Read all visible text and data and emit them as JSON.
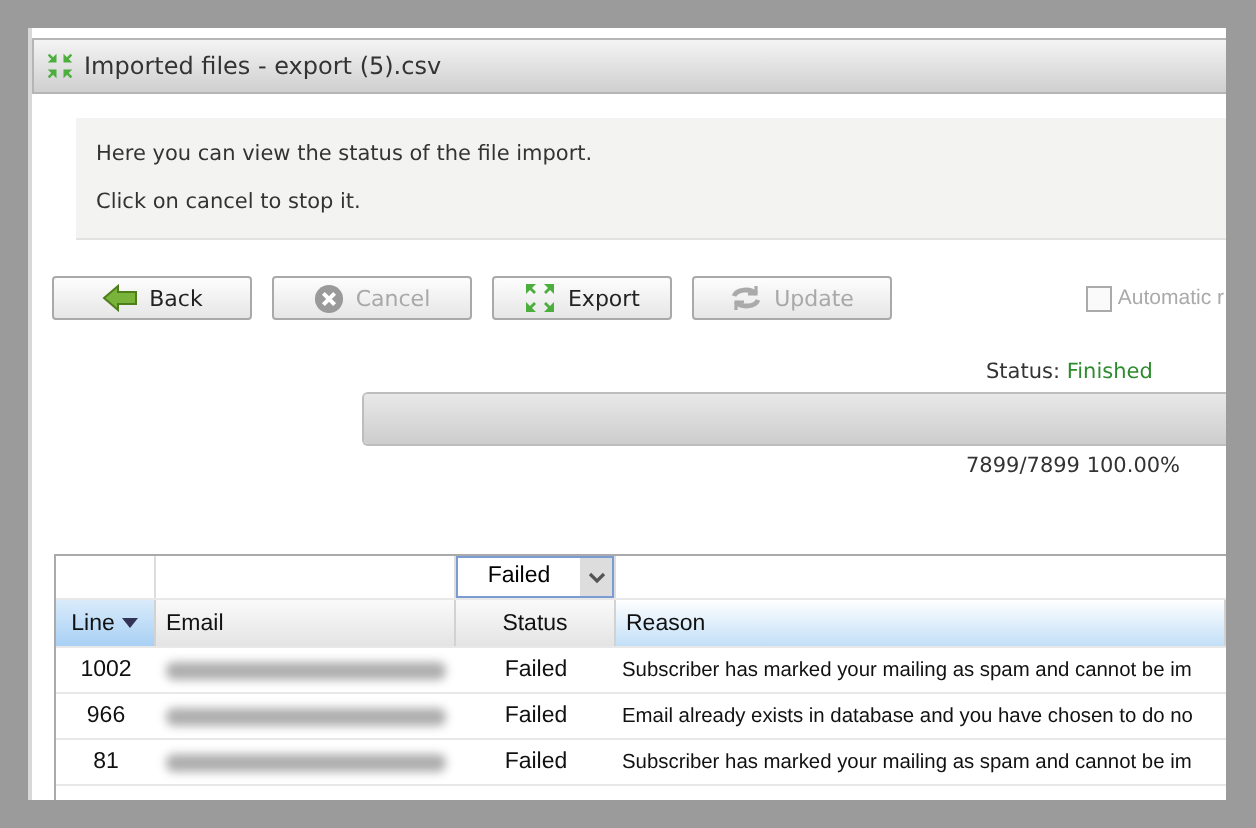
{
  "window": {
    "title": "Imported files - export (5).csv"
  },
  "info": [
    "Here you can view the status of the file import.",
    "Click on cancel to stop it."
  ],
  "buttons": [
    {
      "label": "Back",
      "kind": "back",
      "disabled": false
    },
    {
      "label": "Cancel",
      "kind": "cancel",
      "disabled": true
    },
    {
      "label": "Export",
      "kind": "export",
      "disabled": false
    },
    {
      "label": "Update",
      "kind": "update",
      "disabled": true
    }
  ],
  "auto_refresh": {
    "label": "Automatic r",
    "checked": false,
    "disabled": true
  },
  "status": {
    "label": "Status:",
    "value": "Finished"
  },
  "progress": {
    "level": 1,
    "reading": "7899/7899 100.00%"
  },
  "table": {
    "filter": {
      "value": "Failed"
    },
    "columns": [
      {
        "label": "Line",
        "sorted": true
      },
      {
        "label": "Email",
        "sorted": false
      },
      {
        "label": "Status",
        "sorted": false
      },
      {
        "label": "Reason",
        "sorted": false
      }
    ],
    "rows": [
      {
        "line": "1002",
        "status": "Failed",
        "reason": "Subscriber has marked your mailing as spam and cannot be im"
      },
      {
        "line": "966",
        "status": "Failed",
        "reason": "Email already exists in database and you have chosen to do no"
      },
      {
        "line": "81",
        "status": "Failed",
        "reason": "Subscriber has marked your mailing as spam and cannot be im"
      }
    ]
  }
}
